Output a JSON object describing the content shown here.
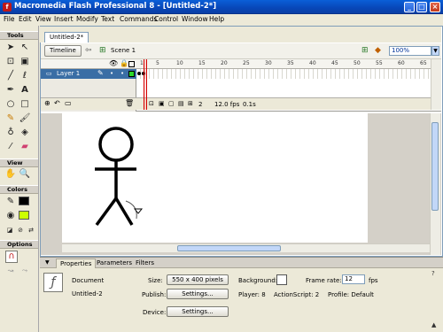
{
  "window": {
    "title": "Macromedia Flash Professional 8 - [Untitled-2*]",
    "app_icon": "flash-icon",
    "controls": {
      "minimize": "_",
      "maximize": "□",
      "close": "×"
    }
  },
  "menubar": {
    "items": [
      "File",
      "Edit",
      "View",
      "Insert",
      "Modify",
      "Text",
      "Commands",
      "Control",
      "Window",
      "Help"
    ]
  },
  "tools": {
    "title": "Tools",
    "view_title": "View",
    "colors_title": "Colors",
    "options_title": "Options",
    "icons": [
      "arrow-tool-icon",
      "subselect-tool-icon",
      "free-transform-icon",
      "fill-transform-icon",
      "line-tool-icon",
      "lasso-tool-icon",
      "pen-tool-icon",
      "text-tool-icon",
      "oval-tool-icon",
      "rectangle-tool-icon",
      "pencil-tool-icon",
      "brush-tool-icon",
      "ink-bottle-icon",
      "paint-bucket-icon",
      "eyedropper-icon",
      "eraser-icon",
      "hand-tool-icon",
      "zoom-tool-icon",
      "stroke-color-icon",
      "fill-color-icon",
      "snap-magnet-icon"
    ],
    "colors": {
      "stroke": "#000000",
      "fill": "#ccff00"
    }
  },
  "document": {
    "tab": "Untitled-2*",
    "timeline_button": "Timeline",
    "scene": "Scene 1",
    "zoom": "100%"
  },
  "timeline": {
    "layer_name": "Layer 1",
    "ruler": [
      "1",
      "5",
      "10",
      "15",
      "20",
      "25",
      "30",
      "35",
      "40",
      "45",
      "50",
      "55",
      "60",
      "65"
    ],
    "current_frame": "2",
    "frame_rate": "12.0 fps",
    "elapsed": "0.1s"
  },
  "properties": {
    "tabs": [
      "Properties",
      "Parameters",
      "Filters"
    ],
    "doc_type": "Document",
    "doc_name": "Untitled-2",
    "size_label": "Size:",
    "size_value": "550 x 400 pixels",
    "background_label": "Background:",
    "background_color": "#ffffff",
    "framerate_label": "Frame rate:",
    "framerate_value": "12",
    "fps_label": "fps",
    "publish_label": "Publish:",
    "settings_label": "Settings...",
    "player_label": "Player: 8",
    "actionscript_label": "ActionScript: 2",
    "profile_label": "Profile: Default",
    "device_label": "Device:",
    "device_settings_label": "Settings..."
  }
}
